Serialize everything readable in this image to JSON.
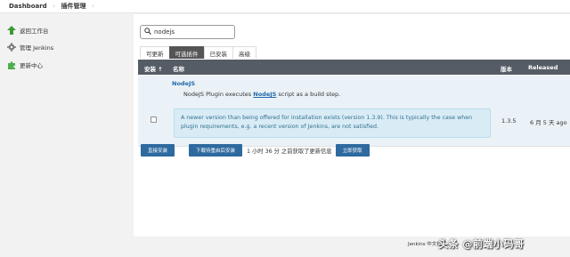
{
  "breadcrumb": {
    "home": "Dashboard",
    "current": "插件管理"
  },
  "sidebar": {
    "items": [
      {
        "label": "返回工作台",
        "icon": "up-arrow-icon"
      },
      {
        "label": "管理 Jenkins",
        "icon": "gear-icon"
      },
      {
        "label": "更新中心",
        "icon": "puzzle-icon"
      }
    ]
  },
  "search": {
    "value": "nodejs",
    "placeholder": ""
  },
  "tabs": [
    {
      "label": "可更新",
      "active": false
    },
    {
      "label": "可选插件",
      "active": true
    },
    {
      "label": "已安装",
      "active": false
    },
    {
      "label": "高级",
      "active": false
    }
  ],
  "table": {
    "headers": {
      "install": "安装 ↑",
      "name": "名称",
      "version": "版本",
      "released": "Released"
    },
    "row": {
      "name": "NodeJS",
      "desc_prefix": "NodeJS Plugin executes ",
      "desc_link": "NodeJS",
      "desc_suffix": " script as a build step.",
      "warning": "A newer version than being offered for installation exists (version 1.3.9). This is typically the case when plugin requirements, e.g. a recent version of Jenkins, are not satisfied.",
      "version": "1.3.5",
      "released": "6 月 5 天 ago"
    }
  },
  "actions": {
    "install_now": "直接安装",
    "download_restart": "下载待重启后安装",
    "status": "1 小时 36 分 之前获取了更新信息",
    "fetch_now": "立即获取"
  },
  "footer": {
    "text": "Jenkins 中文社区",
    "watermark": "头条 @前端小码哥"
  },
  "colors": {
    "accent": "#2e6a9f",
    "table_header": "#555c66",
    "row_bg": "#eaf2f8",
    "warning_bg": "#d9ecf6"
  }
}
